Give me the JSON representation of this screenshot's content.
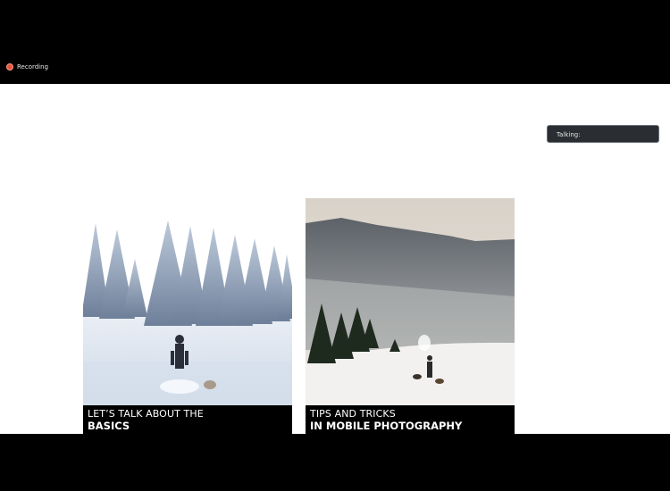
{
  "recording": {
    "label": "Recording",
    "icon": "record-dot-icon"
  },
  "talking": {
    "label": "Talking:"
  },
  "cards": [
    {
      "line1": "LET’S TALK ABOUT THE",
      "line2": "BASICS"
    },
    {
      "line1": "TIPS AND TRICKS",
      "line2": "IN MOBILE PHOTOGRAPHY"
    }
  ],
  "colors": {
    "recording_dot": "#e8553d",
    "talking_bg": "#2a2e33",
    "caption_bg": "#000000"
  }
}
